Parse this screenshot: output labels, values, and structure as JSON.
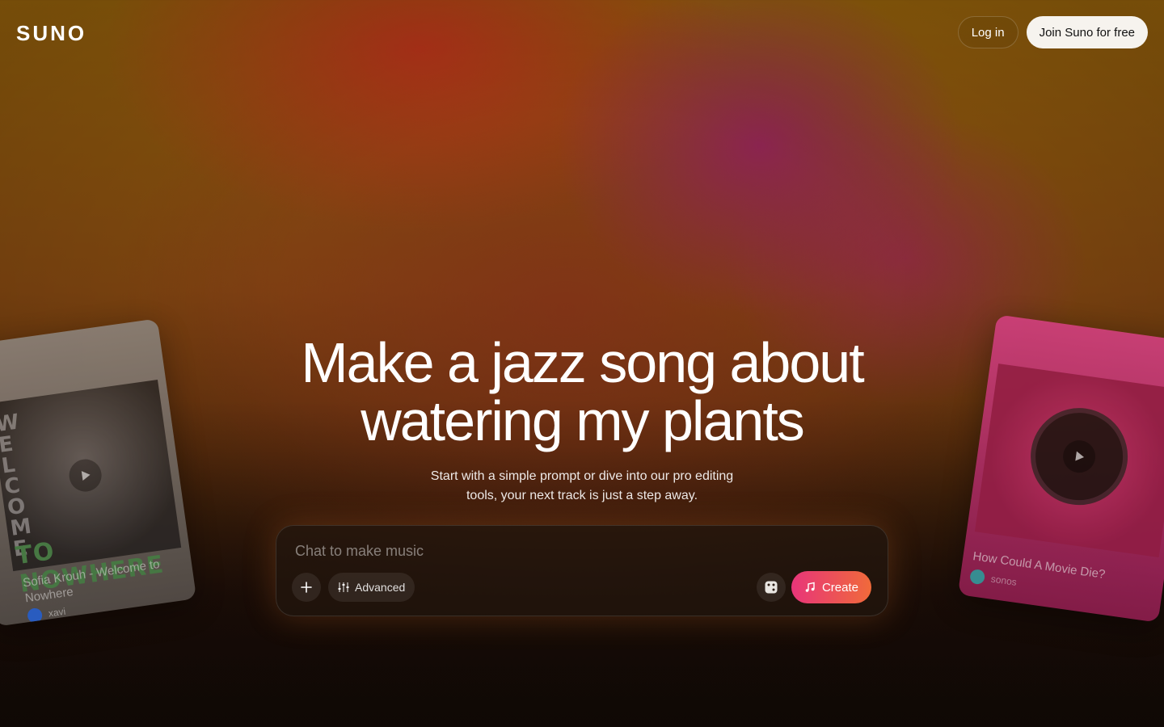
{
  "header": {
    "logo": "SUNO",
    "login_label": "Log in",
    "join_label": "Join Suno for free"
  },
  "hero": {
    "title_line1": "Make a jazz song about",
    "title_line2": "watering my plants",
    "subtitle_line1": "Start with a simple prompt or dive into our pro editing",
    "subtitle_line2": "tools, your next track is just a step away."
  },
  "composer": {
    "placeholder": "Chat to make music",
    "advanced_label": "Advanced",
    "create_label": "Create"
  },
  "cards": {
    "left": {
      "art_vertical": "WELCOME",
      "art_text": "TO NOWHERE",
      "title": "Sofia Krouh - Welcome to Nowhere",
      "author": "xavi"
    },
    "right": {
      "title": "How Could A Movie Die?",
      "author": "sonos"
    }
  },
  "colors": {
    "create_gradient_start": "#e8357a",
    "create_gradient_end": "#f06a3a",
    "join_button_bg": "#f6f3ee"
  }
}
